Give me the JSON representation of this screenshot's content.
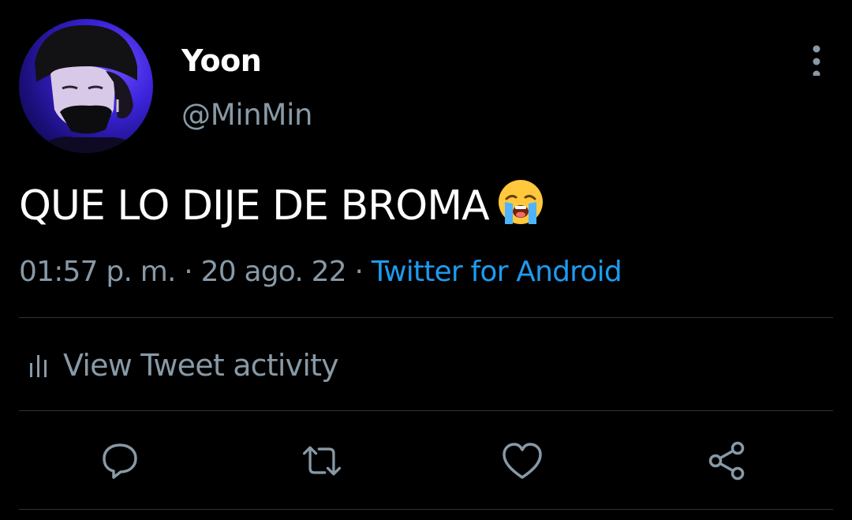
{
  "author": {
    "display_name": "Yoon",
    "handle": "@MinMin",
    "avatar_icon": "profile-photo"
  },
  "tweet": {
    "text": "QUE LO DIJE DE BROMA",
    "emoji": "loudly-crying-face-emoji",
    "time": "01:57 p. m.",
    "separator": "·",
    "date": "20 ago. 22",
    "source": "Twitter for Android"
  },
  "activity": {
    "label": "View Tweet activity",
    "icon": "bar-chart-icon"
  },
  "actions": [
    {
      "name": "reply",
      "icon": "reply-icon"
    },
    {
      "name": "retweet",
      "icon": "retweet-icon"
    },
    {
      "name": "like",
      "icon": "heart-icon"
    },
    {
      "name": "share",
      "icon": "share-icon"
    }
  ],
  "colors": {
    "background": "#000000",
    "text_primary": "#ffffff",
    "text_secondary": "#8899a6",
    "link": "#1d9bf0",
    "divider": "#2f3336"
  }
}
